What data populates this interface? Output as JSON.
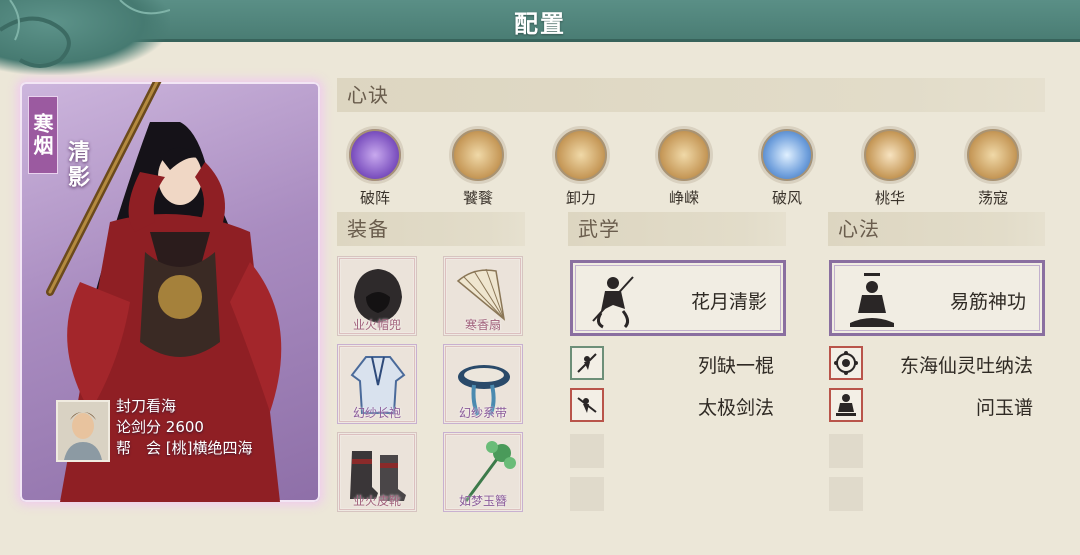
{
  "header": {
    "title": "配置"
  },
  "character": {
    "title_tag": "寒烟",
    "name": "清影",
    "player_name": "封刀看海",
    "score_label": "论剑分",
    "score": "2600",
    "guild_label": "帮　会",
    "guild": "[桃]横绝四海"
  },
  "sections": {
    "xinjue": "心诀",
    "equipment": "装备",
    "martial": "武学",
    "method": "心法"
  },
  "skills": [
    {
      "label": "破阵",
      "icon": "purple-burst-icon",
      "color": "#8a60c8"
    },
    {
      "label": "饕餮",
      "icon": "beast-icon",
      "color": "#c79a5a"
    },
    {
      "label": "卸力",
      "icon": "swirl-icon",
      "color": "#c79a5a"
    },
    {
      "label": "峥嵘",
      "icon": "dragon-icon",
      "color": "#c79a5a"
    },
    {
      "label": "破风",
      "icon": "wind-rays-icon",
      "color": "#5f8fcf"
    },
    {
      "label": "桃华",
      "icon": "lady-icon",
      "color": "#c79a5a"
    },
    {
      "label": "荡寇",
      "icon": "warrior-icon",
      "color": "#c79a5a"
    }
  ],
  "equipment": [
    {
      "label": "业火帽兜",
      "icon": "hood-icon"
    },
    {
      "label": "寒香扇",
      "icon": "fan-icon"
    },
    {
      "label": "幻纱长袍",
      "icon": "robe-icon"
    },
    {
      "label": "幻纱系带",
      "icon": "sash-icon"
    },
    {
      "label": "业火皮靴",
      "icon": "boots-icon"
    },
    {
      "label": "如梦玉簪",
      "icon": "hairpin-icon"
    }
  ],
  "martial": {
    "main": "花月清影",
    "subs": [
      "列缺一棍",
      "太极剑法"
    ]
  },
  "method": {
    "main": "易筋神功",
    "subs": [
      "东海仙灵吐纳法",
      "问玉谱"
    ]
  }
}
